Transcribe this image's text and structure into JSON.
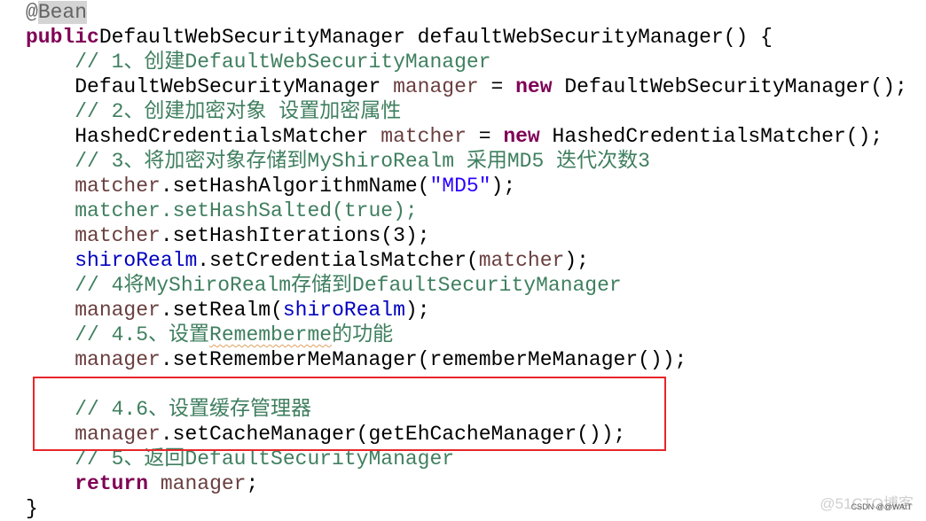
{
  "colors": {
    "keyword": "#7F0055",
    "comment": "#3F7F5F",
    "local_variable": "#6A3E3E",
    "field": "#0000C0",
    "string": "#2A00FF",
    "annotation": "#646464",
    "highlight_box": "#e8262a"
  },
  "code_lines": [
    [
      [
        "an",
        "@"
      ],
      [
        "an hl",
        "Bean"
      ]
    ],
    [
      [
        "kw",
        "public"
      ],
      [
        "",
        "DefaultWebSecurityManager defaultWebSecurityManager() {"
      ]
    ],
    [
      [
        "",
        "    "
      ],
      [
        "cm",
        "// 1、创建DefaultWebSecurityManager"
      ]
    ],
    [
      [
        "",
        "    DefaultWebSecurityManager "
      ],
      [
        "lv",
        "manager"
      ],
      [
        "",
        " = "
      ],
      [
        "kw",
        "new"
      ],
      [
        "",
        " DefaultWebSecurityManager();"
      ]
    ],
    [
      [
        "",
        "    "
      ],
      [
        "cm",
        "// 2、创建加密对象 设置加密属性"
      ]
    ],
    [
      [
        "",
        "    HashedCredentialsMatcher "
      ],
      [
        "lv",
        "matcher"
      ],
      [
        "",
        " = "
      ],
      [
        "kw",
        "new"
      ],
      [
        "",
        " HashedCredentialsMatcher();"
      ]
    ],
    [
      [
        "",
        "    "
      ],
      [
        "cm",
        "// 3、将加密对象存储到MyShiroRealm 采用MD5 迭代次数3"
      ]
    ],
    [
      [
        "",
        "    "
      ],
      [
        "lv",
        "matcher"
      ],
      [
        "",
        ".setHashAlgorithmName("
      ],
      [
        "st",
        "\"MD5\""
      ],
      [
        "",
        ");"
      ]
    ],
    [
      [
        "",
        "    "
      ],
      [
        "cm",
        "matcher.setHashSalted(true);"
      ]
    ],
    [
      [
        "",
        "    "
      ],
      [
        "lv",
        "matcher"
      ],
      [
        "",
        ".setHashIterations(3);"
      ]
    ],
    [
      [
        "",
        "    "
      ],
      [
        "fd",
        "shiroRealm"
      ],
      [
        "",
        ".setCredentialsMatcher("
      ],
      [
        "lv",
        "matcher"
      ],
      [
        "",
        ");"
      ]
    ],
    [
      [
        "",
        "    "
      ],
      [
        "cm",
        "// 4将MyShiroRealm存储到DefaultSecurityManager"
      ]
    ],
    [
      [
        "",
        "    "
      ],
      [
        "lv",
        "manager"
      ],
      [
        "",
        ".setRealm("
      ],
      [
        "fd",
        "shiroRealm"
      ],
      [
        "",
        ");"
      ]
    ],
    [
      [
        "",
        "    "
      ],
      [
        "cm",
        "// 4.5、设置"
      ],
      [
        "cm sq",
        "Rememberme"
      ],
      [
        "cm",
        "的功能"
      ]
    ],
    [
      [
        "",
        "    "
      ],
      [
        "lv",
        "manager"
      ],
      [
        "",
        ".setRememberMeManager(rememberMeManager());"
      ]
    ],
    [
      [
        "",
        ""
      ]
    ],
    [
      [
        "",
        "    "
      ],
      [
        "cm",
        "// 4.6、设置缓存管理器"
      ]
    ],
    [
      [
        "",
        "    "
      ],
      [
        "lv",
        "manager"
      ],
      [
        "",
        ".setCacheManager(getEhCacheManager());"
      ]
    ],
    [
      [
        "",
        "    "
      ],
      [
        "cm",
        "// 5、返回DefaultSecurityManager"
      ]
    ],
    [
      [
        "",
        "    "
      ],
      [
        "kw",
        "return"
      ],
      [
        "",
        " "
      ],
      [
        "lv",
        "manager"
      ],
      [
        "",
        ";"
      ]
    ],
    [
      [
        "",
        "}"
      ]
    ]
  ],
  "watermark": {
    "primary": "@51CTO博客",
    "secondary": "CSDN @@WAIT"
  }
}
